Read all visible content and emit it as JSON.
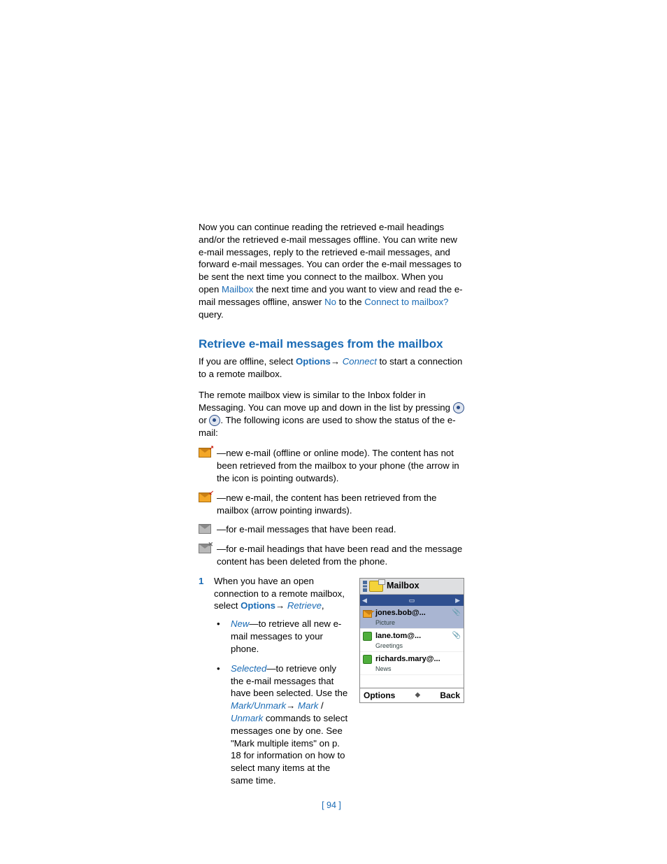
{
  "intro": {
    "p1a": "Now you can continue reading the retrieved e-mail headings and/or the retrieved e-mail messages offline. You can write new e-mail messages, reply to the retrieved e-mail messages, and forward e-mail messages. You can order the e-mail messages to be sent the next time you connect to the mailbox. When you open ",
    "mailbox": "Mailbox",
    "p1b": " the next time and you want to view and read the e-mail messages offline, answer ",
    "no": "No",
    "p1c": " to the ",
    "connect_q": "Connect to mailbox?",
    "p1d": " query."
  },
  "section_title": "Retrieve e-mail messages from the mailbox",
  "offline": {
    "a": "If you are offline, select ",
    "options": "Options",
    "arrow": "→ ",
    "connect": "Connect",
    "b": " to start a connection to a remote mailbox."
  },
  "remote": {
    "a": "The remote mailbox view is similar to the Inbox folder in Messaging. You can move up and down in the list by pressing ",
    "or": " or ",
    "b": ". The following icons are used to show the status of the e-mail:"
  },
  "icons": {
    "i1": "—new e-mail (offline or online mode). The content has not been retrieved from the mailbox to your phone (the arrow in the icon is pointing outwards).",
    "i2": "—new e-mail, the content has been retrieved from the mailbox (arrow pointing inwards).",
    "i3": "—for e-mail messages that have been read.",
    "i4": "—for e-mail headings that have been read and the message content has been deleted from the phone."
  },
  "step1": {
    "num": "1",
    "a": "When you have an open connection to a remote mailbox, select ",
    "options": "Options",
    "arrow": "→ ",
    "retrieve": "Retrieve",
    "comma": ",",
    "new_label": "New",
    "new_text": "—to retrieve all new e-mail messages to your phone.",
    "sel_label": "Selected",
    "sel_a": "—to retrieve only the e-mail messages that have been selected. Use the ",
    "mu": "Mark/Unmark",
    "arrow2": "→ ",
    "mark": "Mark",
    "slash": " / ",
    "unmark": "Unmark",
    "sel_b": " commands to select messages one by one. See \"Mark multiple items\" on p. 18 for information on how to select many items at the same time."
  },
  "phone": {
    "title": "Mailbox",
    "rows": [
      {
        "sender": "jones.bob@...",
        "subject": "Picture",
        "attach": true,
        "unread": true
      },
      {
        "sender": "lane.tom@...",
        "subject": "Greetings",
        "attach": true,
        "unread": false
      },
      {
        "sender": "richards.mary@...",
        "subject": "News",
        "attach": false,
        "unread": false
      }
    ],
    "left": "Options",
    "right": "Back"
  },
  "page_number": "[ 94 ]"
}
